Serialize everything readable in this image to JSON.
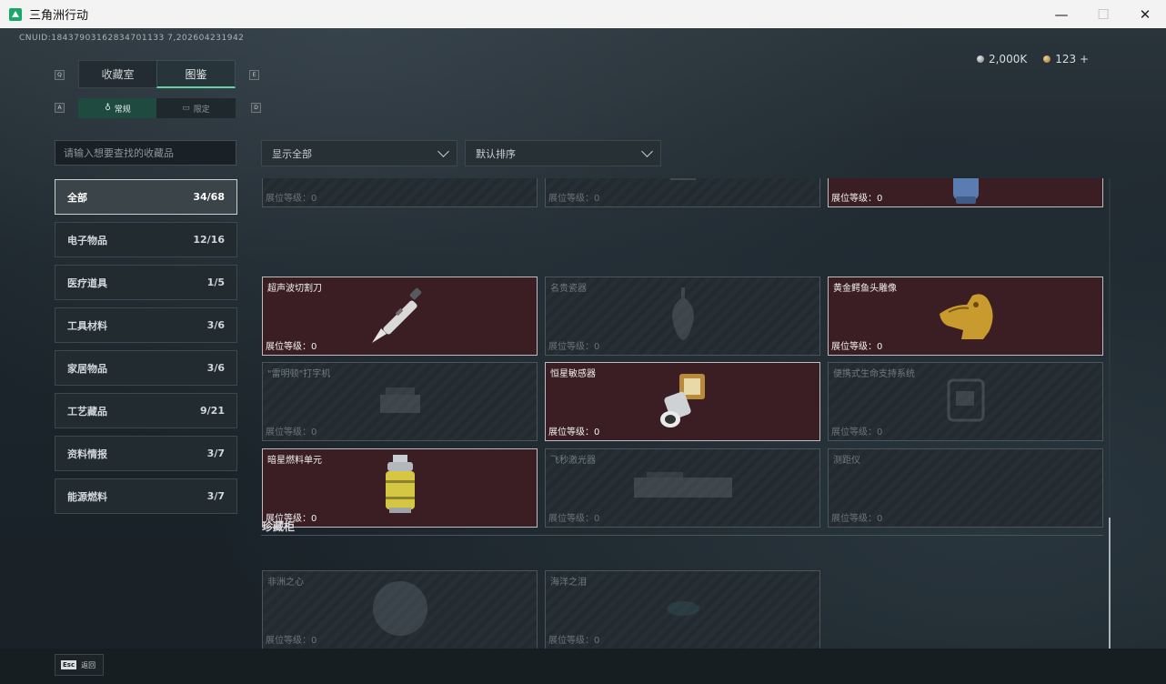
{
  "window": {
    "title": "三角洲行动",
    "controls": [
      "—",
      "☐",
      "✕"
    ]
  },
  "header": {
    "cnuid": "CNUID:18437903162834701133 7,202604231942",
    "currency": [
      {
        "icon": "silver-coin-icon",
        "value": "2,000K"
      },
      {
        "icon": "gold-coin-icon",
        "value": "123 +"
      }
    ],
    "key_hints": [
      "Q",
      "E",
      "A",
      "D"
    ]
  },
  "tabs": {
    "main": [
      {
        "label": "收藏室",
        "active": false
      },
      {
        "label": "图鉴",
        "active": true
      }
    ],
    "sub": [
      {
        "label": "常规",
        "icon": "flame-icon",
        "active": true
      },
      {
        "label": "限定",
        "icon": "ticket-icon",
        "active": false
      }
    ]
  },
  "search": {
    "placeholder": "请输入想要查找的收藏品",
    "value": ""
  },
  "categories": [
    {
      "label": "全部",
      "count": "34/68",
      "active": true
    },
    {
      "label": "电子物品",
      "count": "12/16",
      "active": false
    },
    {
      "label": "医疗道具",
      "count": "1/5",
      "active": false
    },
    {
      "label": "工具材料",
      "count": "3/6",
      "active": false
    },
    {
      "label": "家居物品",
      "count": "3/6",
      "active": false
    },
    {
      "label": "工艺藏品",
      "count": "9/21",
      "active": false
    },
    {
      "label": "资料情报",
      "count": "3/7",
      "active": false
    },
    {
      "label": "能源燃料",
      "count": "3/7",
      "active": false
    }
  ],
  "filters": {
    "display": "显示全部",
    "sort": "默认排序"
  },
  "level_prefix": "展位等级：",
  "items": [
    {
      "name": "",
      "level": "0",
      "collected": false,
      "icon": "unknown-item-icon"
    },
    {
      "name": "",
      "level": "0",
      "collected": false,
      "icon": "unknown-item-icon"
    },
    {
      "name": "",
      "level": "0",
      "collected": true,
      "icon": "gas-canister-icon"
    },
    {
      "name": "超声波切割刀",
      "level": "0",
      "collected": true,
      "icon": "ultrasonic-knife-icon"
    },
    {
      "name": "名贵瓷器",
      "level": "0",
      "collected": false,
      "icon": "porcelain-vase-icon"
    },
    {
      "name": "黄金鳄鱼头雕像",
      "level": "0",
      "collected": true,
      "icon": "golden-crocodile-statue-icon"
    },
    {
      "name": "\"雷明顿\"打字机",
      "level": "0",
      "collected": false,
      "icon": "typewriter-icon"
    },
    {
      "name": "恒星敏感器",
      "level": "0",
      "collected": true,
      "icon": "star-sensor-icon"
    },
    {
      "name": "便携式生命支持系统",
      "level": "0",
      "collected": false,
      "icon": "life-support-icon"
    },
    {
      "name": "暗星燃料单元",
      "level": "0",
      "collected": true,
      "icon": "fuel-cell-icon"
    },
    {
      "name": "飞秒激光器",
      "level": "0",
      "collected": false,
      "icon": "laser-icon"
    },
    {
      "name": "测距仪",
      "level": "0",
      "collected": false,
      "icon": "rangefinder-icon"
    }
  ],
  "treasure_section": {
    "title": "珍藏柜",
    "items": [
      {
        "name": "非洲之心",
        "level": "0",
        "collected": false,
        "icon": "gem-icon"
      },
      {
        "name": "海洋之泪",
        "level": "0",
        "collected": false,
        "icon": "teardrop-gem-icon"
      }
    ]
  },
  "footer": {
    "key": "Esc",
    "label": "返回"
  }
}
